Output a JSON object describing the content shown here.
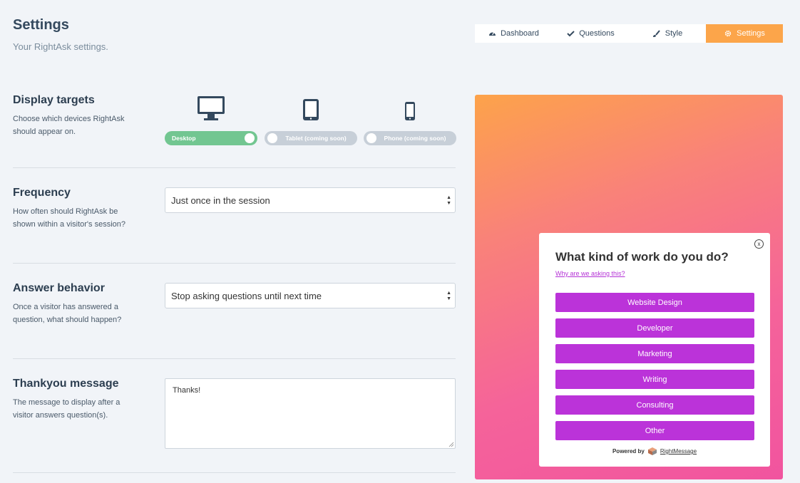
{
  "header": {
    "title": "Settings",
    "subtitle": "Your RightAsk settings."
  },
  "tabs": [
    {
      "label": "Dashboard",
      "icon": "dashboard-icon",
      "active": false
    },
    {
      "label": "Questions",
      "icon": "check-icon",
      "active": false
    },
    {
      "label": "Style",
      "icon": "brush-icon",
      "active": false
    },
    {
      "label": "Settings",
      "icon": "gear-icon",
      "active": true
    }
  ],
  "display_targets": {
    "title": "Display targets",
    "description": "Choose which devices RightAsk should appear on.",
    "devices": [
      {
        "label": "Desktop",
        "icon": "desktop-icon",
        "enabled": true
      },
      {
        "label": "Tablet (coming soon)",
        "icon": "tablet-icon",
        "enabled": false
      },
      {
        "label": "Phone (coming soon)",
        "icon": "phone-icon",
        "enabled": false
      }
    ]
  },
  "frequency": {
    "title": "Frequency",
    "description": "How often should RightAsk be shown within a visitor's session?",
    "value": "Just once in the session"
  },
  "answer_behavior": {
    "title": "Answer behavior",
    "description": "Once a visitor has answered a question, what should happen?",
    "value": "Stop asking questions until next time"
  },
  "thankyou": {
    "title": "Thankyou message",
    "description": "The message to display after a visitor answers question(s).",
    "value": "Thanks!"
  },
  "widget": {
    "close_glyph": "x",
    "question": "What kind of work do you do?",
    "why_link": "Why are we asking this?",
    "answers": [
      "Website Design",
      "Developer",
      "Marketing",
      "Writing",
      "Consulting",
      "Other"
    ],
    "powered_by": "Powered by",
    "brand": "RightMessage",
    "accent": "#bb33d9"
  },
  "colors": {
    "tab_active": "#fca54a",
    "toggle_on": "#72c691",
    "toggle_off": "#c7cfd8"
  }
}
